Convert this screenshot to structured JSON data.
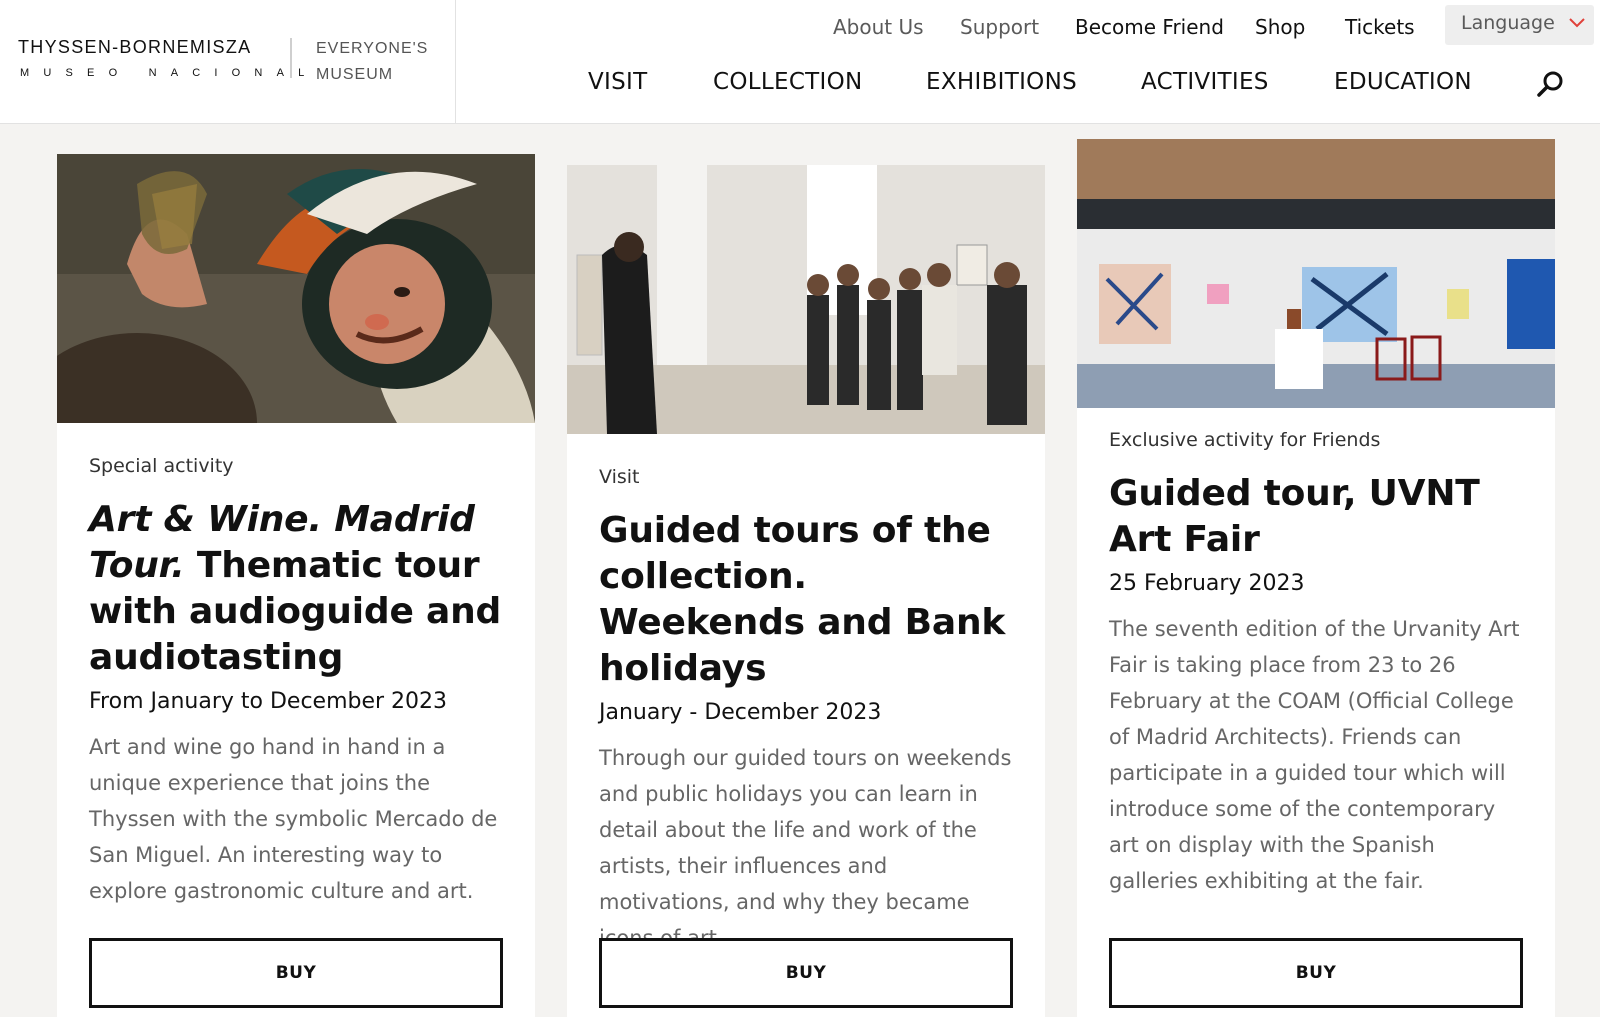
{
  "logo": {
    "name": "THYSSEN-BORNEMISZA",
    "sub": "MUSEO NACIONAL",
    "tagline_line1": "EVERYONE'S",
    "tagline_line2": "MUSEUM"
  },
  "utility_nav": {
    "about": "About Us",
    "support": "Support",
    "friend": "Become Friend",
    "shop": "Shop",
    "tickets": "Tickets",
    "language": "Language"
  },
  "main_nav": {
    "visit": "VISIT",
    "collection": "COLLECTION",
    "exhibitions": "EXHIBITIONS",
    "activities": "ACTIVITIES",
    "education": "EDUCATION"
  },
  "icons": {
    "search": "search-icon",
    "language_chevron": "chevron-down-icon"
  },
  "colors": {
    "accent": "#e0413a",
    "page_bg": "#f4f3f1"
  },
  "cards": [
    {
      "category": "Special activity",
      "title_italic": "Art & Wine. Madrid Tour.",
      "title_rest": " Thematic tour with audioguide and audiotasting",
      "date": "From January to December 2023",
      "description": "Art and wine go hand in hand in a unique experience that joins the Thyssen with the symbolic Mercado de San Miguel. An interesting way to explore gastronomic culture and art.",
      "button": "BUY"
    },
    {
      "category": "Visit",
      "title": "Guided tours of the collection. Weekends and Bank holidays",
      "date": "January - December 2023",
      "description": "Through our guided tours on weekends and public holidays you can learn in detail about the life and work of the artists, their influences and motivations, and why they became icons of art.",
      "button": "BUY"
    },
    {
      "category": "Exclusive activity for Friends",
      "title": "Guided tour, UVNT Art Fair",
      "date": "25 February 2023",
      "description": "The seventh edition of the Urvanity Art Fair is taking place from 23 to 26 February at the COAM (Official College of Madrid Architects). Friends can participate in a guided tour which will introduce some of the contemporary art on display with the Spanish galleries exhibiting at the fair.",
      "button": "BUY"
    }
  ]
}
